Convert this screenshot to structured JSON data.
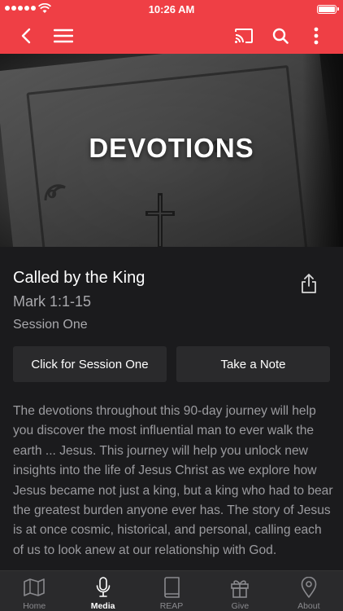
{
  "status_bar": {
    "time": "10:26 AM"
  },
  "hero": {
    "title": "DEVOTIONS"
  },
  "session": {
    "title": "Called by the King",
    "reference": "Mark 1:1-15",
    "session_label": "Session One"
  },
  "actions": {
    "session_button": "Click for Session One",
    "note_button": "Take a Note"
  },
  "description": "The devotions throughout this 90-day journey will help you discover the most influential man to ever walk the earth ... Jesus. This journey will help you unlock new insights into the life of Jesus Christ as we explore how Jesus became not just a king, but a king who had to bear the greatest burden anyone ever has.  The story of Jesus is at once cosmic, historical, and personal, calling each of us to look anew at our relationship with God.",
  "tabs": [
    {
      "label": "Home",
      "icon": "map-icon"
    },
    {
      "label": "Media",
      "icon": "microphone-icon",
      "active": true
    },
    {
      "label": "REAP",
      "icon": "book-icon"
    },
    {
      "label": "Give",
      "icon": "gift-icon"
    },
    {
      "label": "About",
      "icon": "location-pin-icon"
    }
  ],
  "colors": {
    "accent": "#ef3f45",
    "background": "#1b1b1d",
    "tabbar": "#2a2a2c"
  }
}
